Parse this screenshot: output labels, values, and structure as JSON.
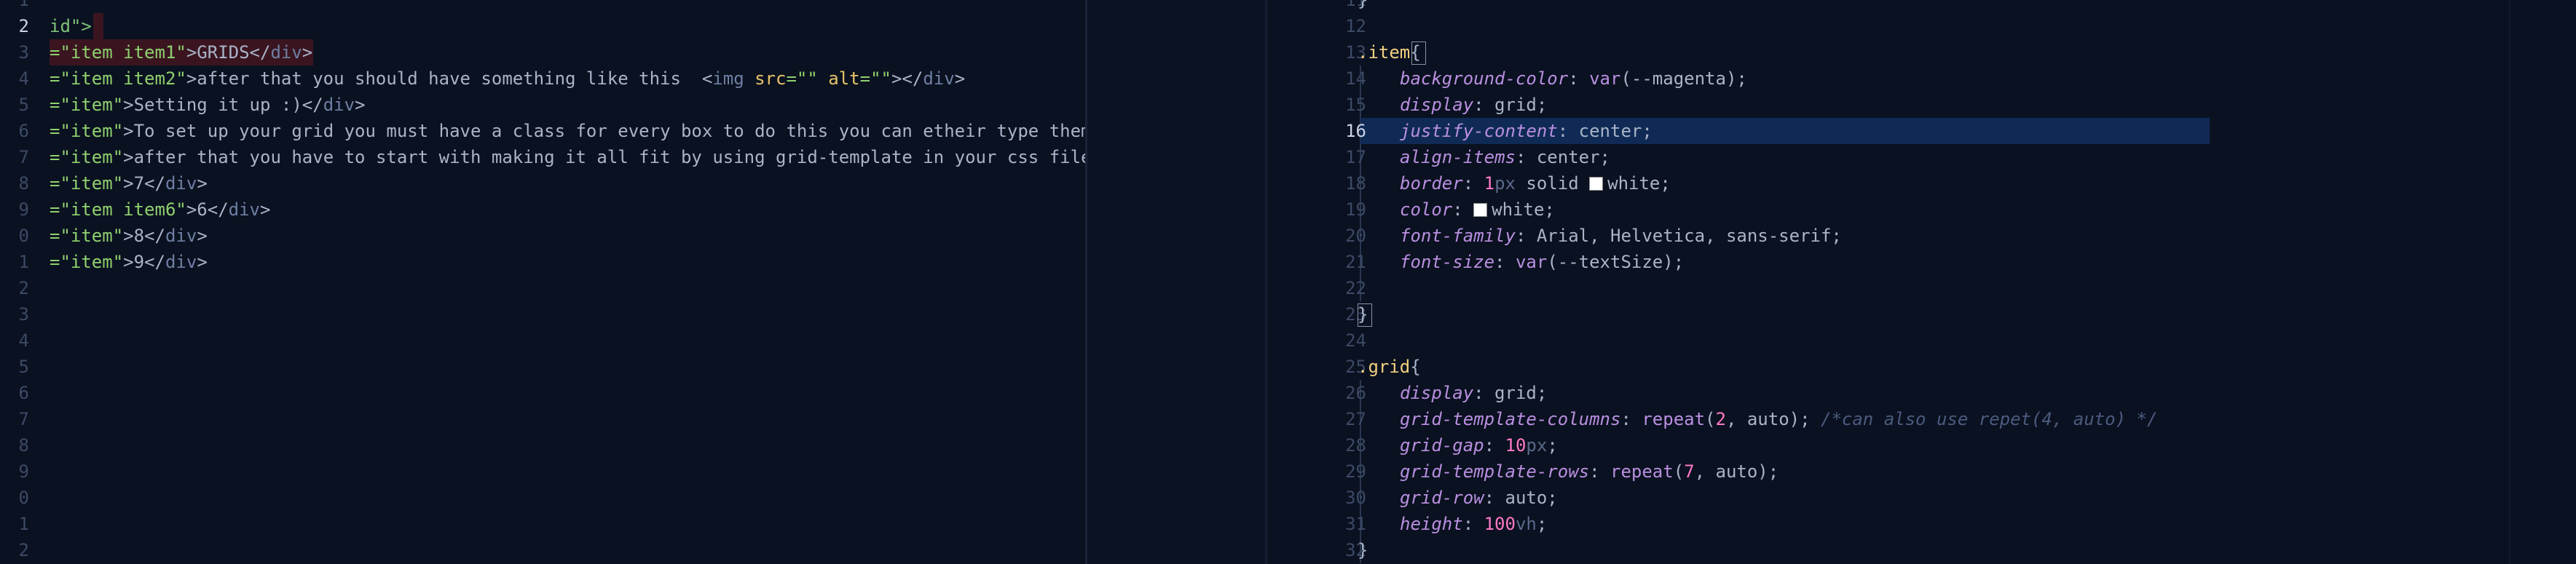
{
  "left_editor": {
    "line_numbers": [
      "1",
      "2",
      "3",
      "4",
      "5",
      "6",
      "7",
      "8",
      "9",
      "0",
      "1",
      "2",
      "3",
      "4",
      "5",
      "6",
      "7",
      "8",
      "9",
      "0",
      "1",
      "2"
    ],
    "active_line": "2",
    "lines": {
      "l2": [
        {
          "t": "id\">",
          "c": "green"
        }
      ],
      "l3": [
        {
          "t": "=\"item item1\"",
          "c": "string"
        },
        {
          "t": ">GRIDS</",
          "c": "default"
        },
        {
          "t": "div",
          "c": "tag"
        },
        {
          "t": ">",
          "c": "default"
        }
      ],
      "l4": [
        {
          "t": "=\"item item2\"",
          "c": "string"
        },
        {
          "t": ">after that you should have something like this  <",
          "c": "default"
        },
        {
          "t": "img ",
          "c": "tag"
        },
        {
          "t": "src",
          "c": "attr"
        },
        {
          "t": "=\"\" ",
          "c": "string"
        },
        {
          "t": "alt",
          "c": "attr"
        },
        {
          "t": "=\"\"",
          "c": "string"
        },
        {
          "t": "></",
          "c": "default"
        },
        {
          "t": "div",
          "c": "tag"
        },
        {
          "t": ">",
          "c": "default"
        }
      ],
      "l5": [
        {
          "t": "=\"item\"",
          "c": "string"
        },
        {
          "t": ">Setting it up :)</",
          "c": "default"
        },
        {
          "t": "div",
          "c": "tag"
        },
        {
          "t": ">",
          "c": "default"
        }
      ],
      "l6": [
        {
          "t": "=\"item\"",
          "c": "string"
        },
        {
          "t": ">To set up your grid you must have a class for every box to do this you can etheir type them",
          "c": "default"
        }
      ],
      "l7": [
        {
          "t": "=\"item\"",
          "c": "string"
        },
        {
          "t": ">after that you have to start with making it all fit by using grid-template in your css file",
          "c": "default"
        }
      ],
      "l8": [
        {
          "t": "=\"item\"",
          "c": "string"
        },
        {
          "t": ">7</",
          "c": "default"
        },
        {
          "t": "div",
          "c": "tag"
        },
        {
          "t": ">",
          "c": "default"
        }
      ],
      "l9": [
        {
          "t": "=\"item item6\"",
          "c": "string"
        },
        {
          "t": ">6</",
          "c": "default"
        },
        {
          "t": "div",
          "c": "tag"
        },
        {
          "t": ">",
          "c": "default"
        }
      ],
      "l10": [
        {
          "t": "=\"item\"",
          "c": "string"
        },
        {
          "t": ">8</",
          "c": "default"
        },
        {
          "t": "div",
          "c": "tag"
        },
        {
          "t": ">",
          "c": "default"
        }
      ],
      "l11": [
        {
          "t": "=\"item\"",
          "c": "string"
        },
        {
          "t": ">9</",
          "c": "default"
        },
        {
          "t": "div",
          "c": "tag"
        },
        {
          "t": ">",
          "c": "default"
        }
      ]
    }
  },
  "right_editor": {
    "line_numbers": [
      "11",
      "12",
      "13",
      "14",
      "15",
      "16",
      "17",
      "18",
      "19",
      "20",
      "21",
      "22",
      "23",
      "24",
      "25",
      "26",
      "27",
      "28",
      "29",
      "30",
      "31",
      "32"
    ],
    "active_line": "16",
    "lines": {
      "r11": [
        {
          "t": "}",
          "c": "punct"
        }
      ],
      "r12": [],
      "r13": [
        {
          "t": ".item",
          "c": "sel"
        },
        {
          "t": "{",
          "c": "punct"
        }
      ],
      "r14": [
        {
          "t": "background-color",
          "c": "prop"
        },
        {
          "t": ": ",
          "c": "punct"
        },
        {
          "t": "var",
          "c": "fn"
        },
        {
          "t": "(--magenta);",
          "c": "val"
        }
      ],
      "r15": [
        {
          "t": "display",
          "c": "prop"
        },
        {
          "t": ": grid;",
          "c": "val"
        }
      ],
      "r16": [
        {
          "t": "justify-content",
          "c": "prop"
        },
        {
          "t": ": center;",
          "c": "val"
        }
      ],
      "r17": [
        {
          "t": "align-items",
          "c": "prop"
        },
        {
          "t": ": center;",
          "c": "val"
        }
      ],
      "r18": [
        {
          "t": "border",
          "c": "prop"
        },
        {
          "t": ": ",
          "c": "punct"
        },
        {
          "t": "1",
          "c": "num"
        },
        {
          "t": "px",
          "c": "unit"
        },
        {
          "t": " solid ",
          "c": "val"
        },
        {
          "t": "swatch",
          "c": "swatch"
        },
        {
          "t": "white;",
          "c": "val"
        }
      ],
      "r19": [
        {
          "t": "color",
          "c": "prop"
        },
        {
          "t": ": ",
          "c": "punct"
        },
        {
          "t": "swatch",
          "c": "swatch"
        },
        {
          "t": "white;",
          "c": "val"
        }
      ],
      "r20": [
        {
          "t": "font-family",
          "c": "prop"
        },
        {
          "t": ": Arial, Helvetica, sans-serif;",
          "c": "val"
        }
      ],
      "r21": [
        {
          "t": "font-size",
          "c": "prop"
        },
        {
          "t": ": ",
          "c": "punct"
        },
        {
          "t": "var",
          "c": "fn"
        },
        {
          "t": "(--textSize);",
          "c": "val"
        }
      ],
      "r22": [],
      "r23": [
        {
          "t": "}",
          "c": "punct"
        }
      ],
      "r24": [],
      "r25": [
        {
          "t": ".grid",
          "c": "sel"
        },
        {
          "t": "{",
          "c": "punct"
        }
      ],
      "r26": [
        {
          "t": "display",
          "c": "prop"
        },
        {
          "t": ": grid;",
          "c": "val"
        }
      ],
      "r27": [
        {
          "t": "grid-template-columns",
          "c": "prop"
        },
        {
          "t": ": ",
          "c": "punct"
        },
        {
          "t": "repeat",
          "c": "fn"
        },
        {
          "t": "(",
          "c": "val"
        },
        {
          "t": "2",
          "c": "num"
        },
        {
          "t": ", auto); ",
          "c": "val"
        },
        {
          "t": "/*can also use repet(4, auto) */",
          "c": "comment"
        }
      ],
      "r28": [
        {
          "t": "grid-gap",
          "c": "prop"
        },
        {
          "t": ": ",
          "c": "punct"
        },
        {
          "t": "10",
          "c": "num"
        },
        {
          "t": "px",
          "c": "unit"
        },
        {
          "t": ";",
          "c": "val"
        }
      ],
      "r29": [
        {
          "t": "grid-template-rows",
          "c": "prop"
        },
        {
          "t": ": ",
          "c": "punct"
        },
        {
          "t": "repeat",
          "c": "fn"
        },
        {
          "t": "(",
          "c": "val"
        },
        {
          "t": "7",
          "c": "num"
        },
        {
          "t": ", auto);",
          "c": "val"
        }
      ],
      "r30": [
        {
          "t": "grid-row",
          "c": "prop"
        },
        {
          "t": ": auto;",
          "c": "val"
        }
      ],
      "r31": [
        {
          "t": "height",
          "c": "prop"
        },
        {
          "t": ": ",
          "c": "punct"
        },
        {
          "t": "100",
          "c": "num"
        },
        {
          "t": "vh",
          "c": "unit"
        },
        {
          "t": ";",
          "c": "val"
        }
      ],
      "r32": [
        {
          "t": "}",
          "c": "punct"
        }
      ]
    }
  }
}
